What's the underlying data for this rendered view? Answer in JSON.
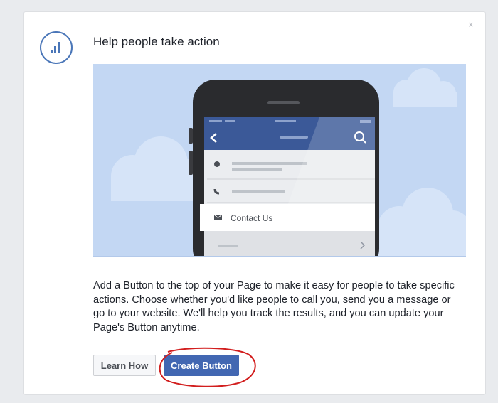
{
  "dialog": {
    "title": "Help people take action",
    "close_glyph": "×",
    "header_icon": "bar-chart-icon",
    "description": "Add a Button to the top of your Page to make it easy for people to take specific actions. Choose whether you'd like people to call you, send you a message or go to your website. We'll help you track the results, and you can update your Page's Button anytime.",
    "learn_label": "Learn How",
    "create_label": "Create Button"
  },
  "illustration": {
    "contact_label": "Contact Us",
    "icons": [
      "back-arrow-icon",
      "search-icon",
      "info-icon",
      "phone-icon",
      "envelope-icon",
      "chevron-right-icon"
    ]
  },
  "colors": {
    "accent": "#4267b2",
    "sky": "#c3d7f3",
    "annotation": "#d21e1e"
  }
}
